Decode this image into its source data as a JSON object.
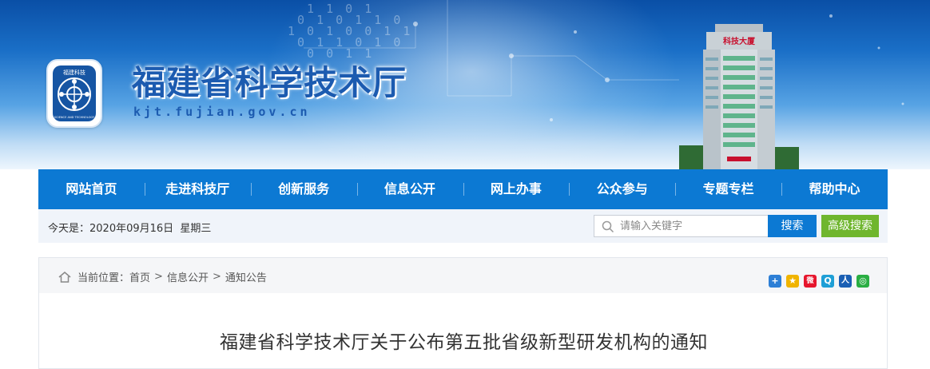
{
  "header": {
    "site_title": "福建省科学技术厅",
    "site_url": "kjt.fujian.gov.cn",
    "logo_ring_text": "福建科技",
    "logo_en_text": "SCIENCE AND TECHNOLOGY",
    "building_sign": "科技大厦"
  },
  "nav": {
    "items": [
      {
        "label": "网站首页"
      },
      {
        "label": "走进科技厅"
      },
      {
        "label": "创新服务"
      },
      {
        "label": "信息公开"
      },
      {
        "label": "网上办事"
      },
      {
        "label": "公众参与"
      },
      {
        "label": "专题专栏"
      },
      {
        "label": "帮助中心"
      }
    ]
  },
  "infobar": {
    "date_text": "今天是：2020年09月16日  星期三",
    "search_placeholder": "请输入关键字",
    "search_button": "搜索",
    "advanced_search_button": "高级搜索"
  },
  "breadcrumb": {
    "prefix": "当前位置：",
    "items": [
      "首页",
      "信息公开",
      "通知公告"
    ],
    "separator": ">"
  },
  "share": {
    "icons": [
      {
        "name": "share-plus-icon",
        "glyph": "+",
        "color": "#2d7fd6"
      },
      {
        "name": "share-qzone-icon",
        "glyph": "★",
        "color": "#f0b400"
      },
      {
        "name": "share-weibo-icon",
        "glyph": "微",
        "color": "#e6162d"
      },
      {
        "name": "share-tencent-icon",
        "glyph": "Q",
        "color": "#1e9fd6"
      },
      {
        "name": "share-renren-icon",
        "glyph": "人",
        "color": "#1a5fb4"
      },
      {
        "name": "share-wechat-icon",
        "glyph": "◎",
        "color": "#2aae43"
      }
    ]
  },
  "article": {
    "title": "福建省科学技术厅关于公布第五批省级新型研发机构的通知"
  },
  "colors": {
    "nav_bg": "#0c79d3",
    "search_button": "#0c79d3",
    "advanced_button": "#6fb62e",
    "title_blue": "#1c5bb0"
  }
}
